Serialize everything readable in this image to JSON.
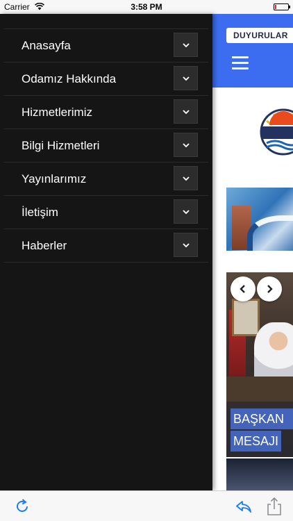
{
  "status_bar": {
    "carrier": "Carrier",
    "time": "3:58 PM",
    "wifi_icon": "wifi-icon",
    "battery_icon": "battery-icon",
    "battery_color": "#e5282c"
  },
  "header": {
    "announcements_label": "DUYURULAR",
    "menu_icon": "hamburger-menu-icon",
    "color": "#3c6df0"
  },
  "drawer": {
    "items": [
      {
        "label": "Anasayfa"
      },
      {
        "label": "Odamız Hakkında"
      },
      {
        "label": "Hizmetlerimiz"
      },
      {
        "label": "Bilgi Hizmetleri"
      },
      {
        "label": "Yayınlarımız"
      },
      {
        "label": "İletişim"
      },
      {
        "label": "Haberler"
      }
    ],
    "expand_icon": "chevron-down-icon"
  },
  "slider": {
    "caption_line1": "BAŞKAN",
    "caption_line2": "MESAJI",
    "prev_icon": "chevron-left-icon",
    "next_icon": "chevron-right-icon"
  },
  "toolbar": {
    "refresh_icon": "refresh-icon",
    "reply_icon": "reply-icon",
    "share_icon": "share-icon",
    "accent": "#1a7cf3"
  }
}
